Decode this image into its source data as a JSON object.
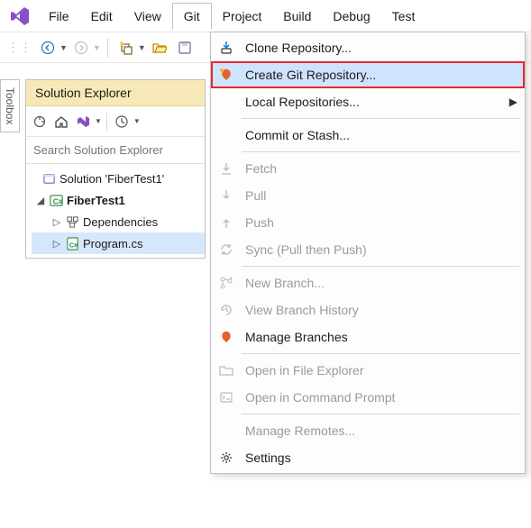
{
  "menubar": {
    "items": [
      "File",
      "Edit",
      "View",
      "Git",
      "Project",
      "Build",
      "Debug",
      "Test"
    ],
    "open_index": 3
  },
  "sidetab": {
    "label": "Toolbox"
  },
  "panel": {
    "title": "Solution Explorer",
    "search_placeholder": "Search Solution Explorer",
    "tree": {
      "solution": "Solution 'FiberTest1'",
      "project": "FiberTest1",
      "dep": "Dependencies",
      "file": "Program.cs"
    }
  },
  "git_menu": {
    "items": [
      {
        "label": "Clone Repository...",
        "icon": "clone",
        "enabled": true
      },
      {
        "label": "Create Git Repository...",
        "icon": "create",
        "enabled": true,
        "highlight": true
      },
      {
        "label": "Local Repositories...",
        "icon": "",
        "enabled": true,
        "submenu": true
      },
      {
        "sep": true
      },
      {
        "label": "Commit or Stash...",
        "icon": "",
        "enabled": true
      },
      {
        "sep": true
      },
      {
        "label": "Fetch",
        "icon": "fetch",
        "enabled": false
      },
      {
        "label": "Pull",
        "icon": "pull",
        "enabled": false
      },
      {
        "label": "Push",
        "icon": "push",
        "enabled": false
      },
      {
        "label": "Sync (Pull then Push)",
        "icon": "sync",
        "enabled": false
      },
      {
        "sep": true
      },
      {
        "label": "New Branch...",
        "icon": "newbranch",
        "enabled": false
      },
      {
        "label": "View Branch History",
        "icon": "history",
        "enabled": false
      },
      {
        "label": "Manage Branches",
        "icon": "branches",
        "enabled": true
      },
      {
        "sep": true
      },
      {
        "label": "Open in File Explorer",
        "icon": "folder",
        "enabled": false
      },
      {
        "label": "Open in Command Prompt",
        "icon": "prompt",
        "enabled": false
      },
      {
        "sep": true
      },
      {
        "label": "Manage Remotes...",
        "icon": "",
        "enabled": false
      },
      {
        "label": "Settings",
        "icon": "gear",
        "enabled": true
      }
    ]
  }
}
